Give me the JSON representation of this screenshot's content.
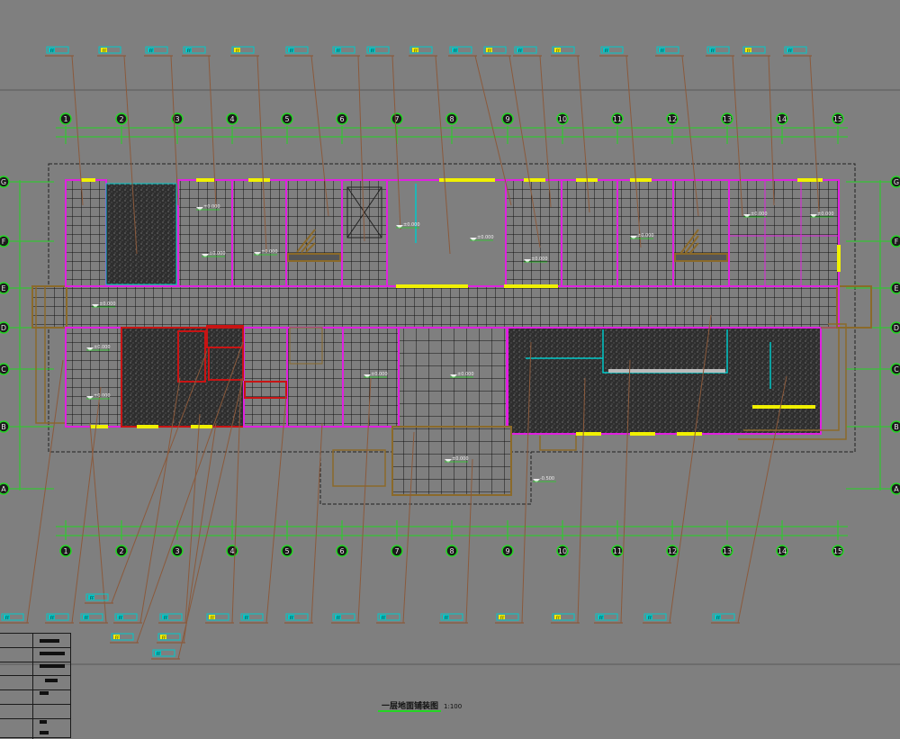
{
  "drawing": {
    "title": "一层地面铺装图",
    "scale": "1:100",
    "grid_columns": [
      "1",
      "2",
      "3",
      "4",
      "5",
      "6",
      "7",
      "8",
      "9",
      "10",
      "11",
      "12",
      "13",
      "14",
      "15"
    ],
    "grid_rows": [
      "A",
      "B",
      "C",
      "D",
      "E",
      "F",
      "G"
    ],
    "elevations": [
      "±0.000",
      "±0.000",
      "±0.000",
      "±0.000",
      "±0.000",
      "±0.000",
      "±0.000",
      "±0.000",
      "±0.000",
      "±0.000",
      "±0.000",
      "±0.000",
      "±0.000",
      "-0.500"
    ],
    "tag_code": "FF"
  },
  "colors": {
    "background": "#7f7f7f",
    "wall": "#e020e0",
    "axis": "#22d622",
    "tile_line": "#111111",
    "leader": "#8b5a3c",
    "window": "#f0f000",
    "stair": "#8b6a2a",
    "dark_floor": "#2e2e2e",
    "cyan_detail": "#00c8c8",
    "red_wall": "#c81414"
  }
}
